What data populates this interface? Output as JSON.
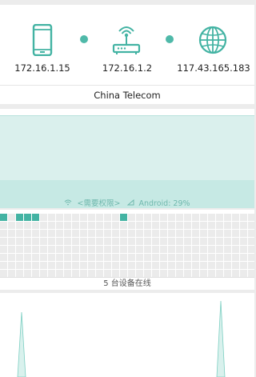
{
  "path": {
    "nodes": [
      {
        "icon": "phone-icon",
        "ip": "172.16.1.15"
      },
      {
        "icon": "router-icon",
        "ip": "172.16.1.2"
      },
      {
        "icon": "globe-icon",
        "ip": "117.43.165.183"
      }
    ],
    "isp": "China Telecom"
  },
  "status": {
    "wifi_text": "<需要权限>",
    "android_text": "Android: 29%"
  },
  "devices": {
    "online_text": "5 台设备在线",
    "active_cells": [
      0,
      2,
      3,
      4,
      15
    ]
  },
  "colors": {
    "accent": "#43b3a3",
    "signal_fill": "#daf0ed",
    "cell_inactive": "#ebebeb"
  }
}
